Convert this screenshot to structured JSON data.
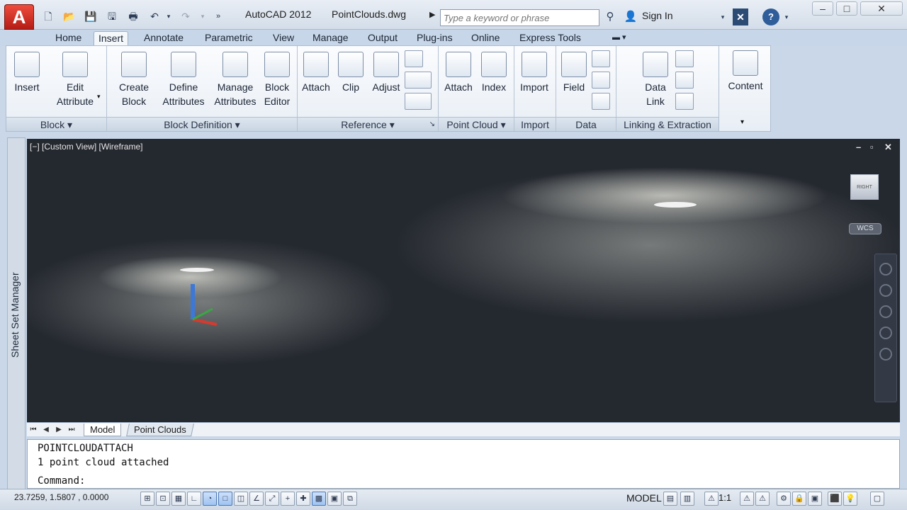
{
  "titlebar": {
    "app_name": "AutoCAD 2012",
    "document": "PointClouds.dwg",
    "search_placeholder": "Type a keyword or phrase",
    "sign_in": "Sign In"
  },
  "ribbon": {
    "tabs": [
      {
        "label": "Home"
      },
      {
        "label": "Insert",
        "active": true
      },
      {
        "label": "Annotate"
      },
      {
        "label": "Parametric"
      },
      {
        "label": "View"
      },
      {
        "label": "Manage"
      },
      {
        "label": "Output"
      },
      {
        "label": "Plug-ins"
      },
      {
        "label": "Online"
      },
      {
        "label": "Express Tools"
      }
    ],
    "panels": {
      "block": {
        "title": "Block",
        "insert": "Insert",
        "edit_attribute_1": "Edit",
        "edit_attribute_2": "Attribute"
      },
      "block_definition": {
        "title": "Block Definition",
        "create_1": "Create",
        "create_2": "Block",
        "define_1": "Define",
        "define_2": "Attributes",
        "manage_1": "Manage",
        "manage_2": "Attributes",
        "editor_1": "Block",
        "editor_2": "Editor"
      },
      "reference": {
        "title": "Reference",
        "attach": "Attach",
        "clip": "Clip",
        "adjust": "Adjust"
      },
      "point_cloud": {
        "title": "Point Cloud",
        "attach": "Attach",
        "index": "Index"
      },
      "import": {
        "title": "Import",
        "import": "Import"
      },
      "data": {
        "title": "Data",
        "field": "Field"
      },
      "linking": {
        "title": "Linking & Extraction",
        "data_link_1": "Data",
        "data_link_2": "Link"
      },
      "content": {
        "content": "Content"
      }
    }
  },
  "side_palette": {
    "label": "Sheet Set Manager"
  },
  "viewport": {
    "label": "[−] [Custom View] [Wireframe]",
    "wcs": "WCS",
    "viewcube_text": "RIGHT"
  },
  "layout_tabs": [
    "Model",
    "Point Clouds"
  ],
  "command": {
    "history": [
      "POINTCLOUDATTACH",
      "1 point cloud attached"
    ],
    "prompt": "Command:"
  },
  "statusbar": {
    "coordinates": "23.7259,  1.5807 , 0.0000",
    "space": "MODEL",
    "annotation_scale": "1:1"
  }
}
